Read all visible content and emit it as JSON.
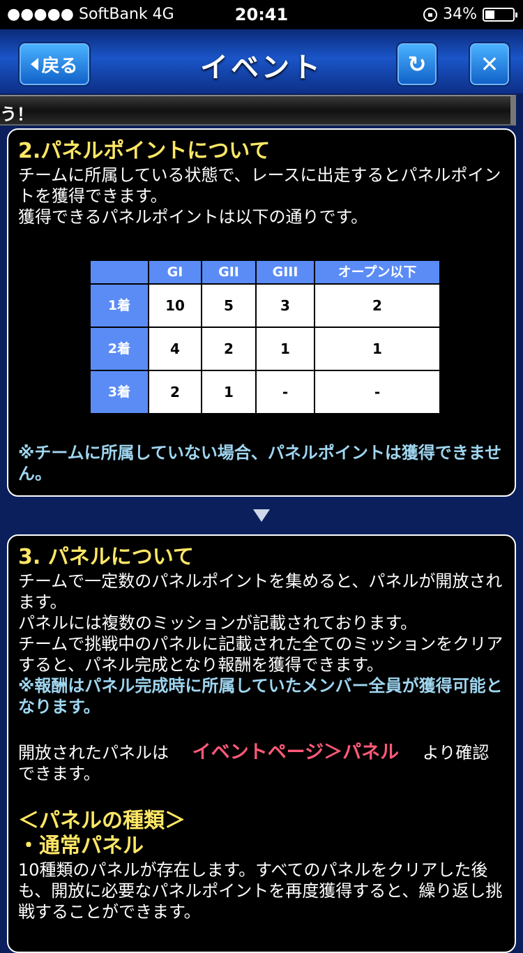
{
  "status": {
    "carrier": "●●●●● SoftBank   4G",
    "time": "20:41",
    "battery": "34%"
  },
  "header": {
    "title": "イベント",
    "back_label": "戻る",
    "reload_icon": "↻",
    "close_icon": "✕"
  },
  "ticker": {
    "text": "う！"
  },
  "section2": {
    "heading": "2.パネルポイントについて",
    "body": [
      "チームに所属している状態で、レースに出走するとパネルポイントを獲得できます。",
      "獲得できるパネルポイントは以下の通りです。"
    ],
    "table": {
      "headers": [
        "",
        "GI",
        "GII",
        "GIII",
        "オープン以下"
      ],
      "rows": [
        {
          "label": "1着",
          "cells": [
            "10",
            "5",
            "3",
            "2"
          ]
        },
        {
          "label": "2着",
          "cells": [
            "4",
            "2",
            "1",
            "1"
          ]
        },
        {
          "label": "3着",
          "cells": [
            "2",
            "1",
            "-",
            "-"
          ]
        }
      ]
    },
    "note": "※チームに所属していない場合、パネルポイントは獲得できません。"
  },
  "section3": {
    "heading": "3. パネルについて",
    "body": [
      "チームで一定数のパネルポイントを集めると、パネルが開放されます。",
      "パネルには複数のミッションが記載されております。",
      "チームで挑戦中のパネルに記載された全てのミッションをクリアすると、パネル完成となり報酬を獲得できます。"
    ],
    "note": "※報酬はパネル完成時に所属していたメンバー全員が獲得可能となります。",
    "open_prefix": "開放されたパネルは",
    "open_link": "イベントページ＞パネル",
    "open_suffix": "より確認できます。",
    "types_heading": "＜パネルの種類＞",
    "normal_heading": "・通常パネル",
    "normal_body": "10種類のパネルが存在します。すべてのパネルをクリアした後も、開放に必要なパネルポイントを再度獲得すると、繰り返し挑戦することができます。"
  }
}
